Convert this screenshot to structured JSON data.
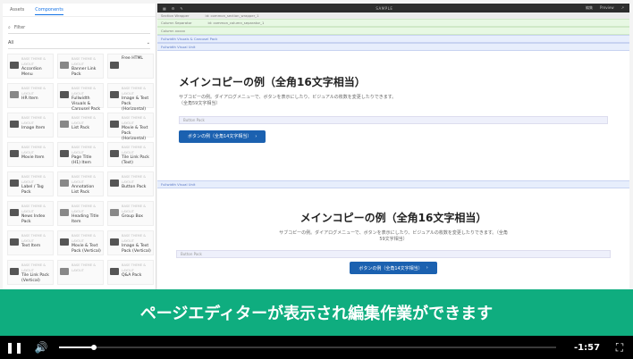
{
  "left_panel": {
    "tabs": [
      "Assets",
      "Components"
    ],
    "active_tab": "Components",
    "filter_placeholder": "Filter",
    "group_value": "All",
    "component_cards": [
      {
        "sub": "BASE THEME & LAYOUT",
        "label": "Accordion Menu"
      },
      {
        "sub": "BASE THEME & LAYOUT",
        "label": "Banner Link Pack"
      },
      {
        "sub": "",
        "label": "Free HTML"
      },
      {
        "sub": "BASE THEME & LAYOUT",
        "label": "HR Item"
      },
      {
        "sub": "BASE THEME & LAYOUT",
        "label": "Fullwidth Visuals & Carousel Pack"
      },
      {
        "sub": "BASE THEME & LAYOUT",
        "label": "Image & Text Pack (Horizontal)"
      },
      {
        "sub": "BASE THEME & LAYOUT",
        "label": "Image Item"
      },
      {
        "sub": "BASE THEME & LAYOUT",
        "label": "List Pack"
      },
      {
        "sub": "BASE THEME & LAYOUT",
        "label": "Movie & Text Pack (Horizontal)"
      },
      {
        "sub": "BASE THEME & LAYOUT",
        "label": "Movie Item"
      },
      {
        "sub": "BASE THEME & LAYOUT",
        "label": "Page Title (H1) Item"
      },
      {
        "sub": "BASE THEME & LAYOUT",
        "label": "Tile Link Pack (Text)"
      },
      {
        "sub": "BASE THEME & LAYOUT",
        "label": "Label / Tag Pack"
      },
      {
        "sub": "BASE THEME & LAYOUT",
        "label": "Annotation List Pack"
      },
      {
        "sub": "BASE THEME & LAYOUT",
        "label": "Button Pack"
      },
      {
        "sub": "BASE THEME & LAYOUT",
        "label": "News Index Pack"
      },
      {
        "sub": "BASE THEME & LAYOUT",
        "label": "Heading Title Item"
      },
      {
        "sub": "BASE THEME & LAYOUT",
        "label": "Group Box"
      },
      {
        "sub": "BASE THEME & LAYOUT",
        "label": "Text Item"
      },
      {
        "sub": "BASE THEME & LAYOUT",
        "label": "Movie & Text Pack (Vertical)"
      },
      {
        "sub": "BASE THEME & LAYOUT",
        "label": "Image & Text Pack (Vertical)"
      },
      {
        "sub": "BASE THEME & LAYOUT",
        "label": "Tile Link Pack (Vertical)"
      },
      {
        "sub": "BASE THEME & LAYOUT",
        "label": ""
      },
      {
        "sub": "BASE THEME & LAYOUT",
        "label": "Q&A Pack"
      }
    ]
  },
  "editor": {
    "top_title": "SAMPLE",
    "top_right_1": "編集",
    "top_right_2": "Preview",
    "section_wrapper_label": "Section Wrapper",
    "section_wrapper_id": "id: common_section_wrapper_1",
    "column_separator_label": "Column Separator",
    "column_separator_id": "id: common_column_separator_1",
    "column_label": "Column xxxxx",
    "fullwidth_visuals_label": "Fullwidth Visuals & Carousel Pack",
    "fullwidth_unit_label": "Fullwidth Visual Unit",
    "heading1": "メインコピーの例（全角16文字相当）",
    "body1": "サブコピーの例。ダイアログメニューで、ボタンを表示にしたり、ビジュアルの枚数を変更したりできます。（全角59文字相当）",
    "button_pack_label": "Button Pack",
    "button_label": "ボタンの例（全角14文字相当）",
    "fullwidth_unit_label_2": "Fullwidth Visual Unit",
    "heading2": "メインコピーの例（全角16文字相当）",
    "body2": "サブコピーの例。ダイアログメニューで、ボタンを表示にしたり、ビジュアルの枚数を変更したりできます。（全角59文字相当）",
    "button_pack_label_2": "Button Pack",
    "button_label_2": "ボタンの例（全角14文字相当）"
  },
  "banner": {
    "caption": "ページエディターが表示され編集作業ができます"
  },
  "player": {
    "time_remaining": "-1:57",
    "progress_fraction": 0.07
  }
}
